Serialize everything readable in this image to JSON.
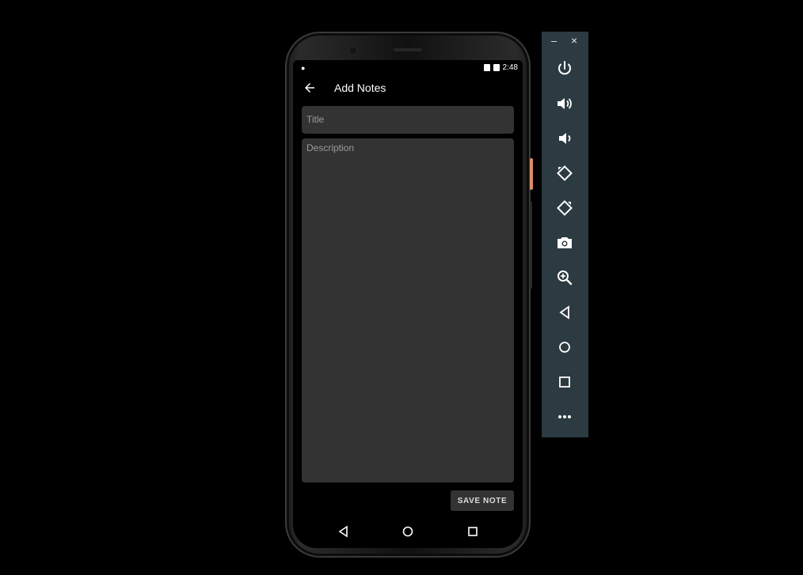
{
  "status_bar": {
    "time": "2:48"
  },
  "app_bar": {
    "title": "Add Notes"
  },
  "form": {
    "title_placeholder": "Title",
    "description_placeholder": "Description",
    "save_label": "SAVE NOTE"
  },
  "nav_bar": {
    "icons": [
      "back-triangle-icon",
      "home-circle-icon",
      "recents-square-icon"
    ]
  },
  "emulator_toolbar": {
    "minimize_label": "–",
    "close_label": "×",
    "buttons": [
      "power",
      "volume-up",
      "volume-down",
      "rotate-left",
      "rotate-right",
      "screenshot",
      "zoom",
      "back",
      "home",
      "overview",
      "more"
    ]
  },
  "colors": {
    "screen_bg": "#000000",
    "field_bg": "#333333",
    "toolbar_bg": "#2c3a41",
    "text": "#ffffff",
    "placeholder": "#9a9a9a"
  }
}
